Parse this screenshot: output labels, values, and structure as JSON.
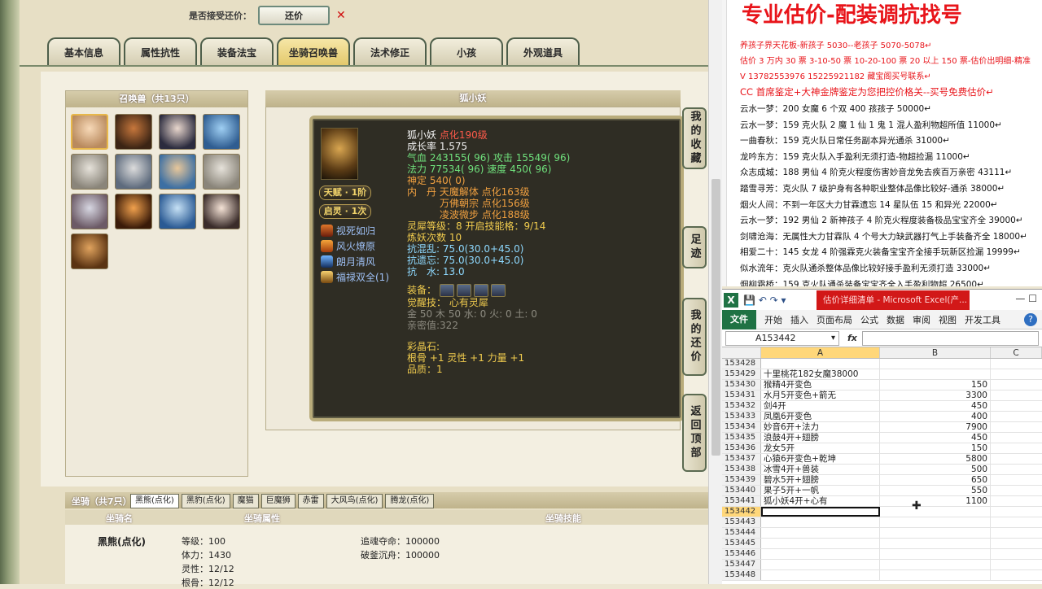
{
  "game": {
    "accept_label": "是否接受还价：",
    "accept_button": "还价",
    "accept_x": "✕",
    "tabs": [
      "基本信息",
      "属性抗性",
      "装备法宝",
      "坐骑召唤兽",
      "法术修正",
      "小孩",
      "外观道具"
    ],
    "active_tab": "坐骑召唤兽",
    "summon_header": "召唤兽（共13只）",
    "portrait_count": 13,
    "detail_title": "狐小妖",
    "pet": {
      "name": "狐小妖",
      "level": "点化190级",
      "growth": "成长率 1.575",
      "hp": "气血 243155( 96)",
      "attack": "攻击 15549( 96)",
      "mp": "法力 77534( 96)",
      "speed": "速度 450( 96)",
      "spirit": "神定 540( 0)",
      "inner_label": "内　丹",
      "inner1": "天魔解体 点化163级",
      "inner2": "万佛朝宗 点化156级",
      "inner3": "凌波微步 点化188级",
      "lingxi": "灵犀等级：8 开启技能格：9/14",
      "lianyao": "炼妖次数 10",
      "kang1": "抗混乱: 75.0(30.0+45.0)",
      "kang2": "抗遗忘: 75.0(30.0+45.0)",
      "kang3": "抗　水: 13.0",
      "equip_label": "装备：",
      "awaken_label": "觉醒技：",
      "awaken_value": "心有灵犀",
      "wuxing": "金 50 木 50 水: 0 火: 0 土: 0",
      "qinmi": "亲密值:322",
      "caijing_label": "彩晶石:",
      "caijing_value": "根骨 +1 灵性 +1 力量 +1",
      "pinzhi": "品质：1"
    },
    "badges": {
      "tianfu": "天赋 · 1阶",
      "qiling": "启灵 · 1次"
    },
    "skills": [
      "视死如归",
      "风火燎原",
      "朗月清风",
      "福禄双全(1)"
    ],
    "side_buttons": [
      "我的收藏",
      "足迹",
      "我的还价",
      "返回顶部"
    ],
    "mount": {
      "title": "坐骑（共7只）",
      "tabs": [
        "黑熊(点化)",
        "黑豹(点化)",
        "魔猫",
        "巨魔狮",
        "赤雷",
        "大风鸟(点化)",
        "腾龙(点化)"
      ],
      "col_name": "坐骑名",
      "col_attr": "坐骑属性",
      "col_skill": "坐骑技能",
      "name": "黑熊(点化)",
      "attrs": [
        "等级：100",
        "体力：1430",
        "灵性：12/12",
        "根骨：12/12"
      ],
      "skills": [
        "追魂夺命：100000",
        "破釜沉舟：100000"
      ]
    }
  },
  "doc": {
    "heading": "专业估价-配装调抗找号",
    "lines_red": [
      "养孩子界天花板-新孩子 5030--老孩子 5070-5078↵",
      "估价 3 万内 30 票  3-10-50 票  10-20-100 票  20 以上 150 票-估价出明细-精准",
      "V 13782553976    15225921182  藏宝阁买号联系↵",
      "CC 首席鉴定+大神金牌鉴定为您把控价格关--买号免费估价↵"
    ],
    "lines": [
      "云水一梦：200 女魔 6 个双 400 孩孩子 50000↵",
      "云水一梦：159 克火队 2 魔 1 仙 1 鬼 1 混人盈利物超所值 11000↵",
      "一曲春秋：159 克火队日常任务副本异光通杀 31000↵",
      "龙吟东方：159 克火队入手盈利无须打造-物超捡漏 11000↵",
      "众志成城：188 男仙 4 阶克火程度伤害妙音龙免去疾百万亲密 43111↵",
      "踏雪寻芳：克火队 7 级护身有各种职业整体品像比较好-通杀 38000↵",
      "烟火人间：不到一年区大力甘霖遗忘 14 星队伍 15 和异光 22000↵",
      "云水一梦：192 男仙 2 新神孩子 4 阶克火程度装备极品宝宝齐全 39000↵",
      "剑啸沧海：无属性大力甘霖队 4 个号大力缺武器打气上手装备齐全 18000↵",
      "相爱二十：145 女龙 4 阶强霖克火装备宝宝齐全接手玩新区捡漏 19999↵",
      "似水流年：克火队通杀整体品像比较好接手盈利无须打造 33000↵",
      "烟柳霜桥：159 克火队通杀装备宝宝齐全入手盈利物超 26500↵"
    ]
  },
  "excel": {
    "icon": "X",
    "title": "估价详细清单 - Microsoft Excel(产...",
    "ribbon": [
      "文件",
      "开始",
      "插入",
      "页面布局",
      "公式",
      "数据",
      "审阅",
      "视图",
      "开发工具"
    ],
    "help": "?",
    "namebox": "A153442",
    "fx": "fx",
    "cols": [
      "A",
      "B",
      "C"
    ],
    "rows": [
      {
        "n": "153428",
        "a": "",
        "b": ""
      },
      {
        "n": "153429",
        "a": "十里桃花182女魔38000",
        "b": ""
      },
      {
        "n": "153430",
        "a": "猴精4开变色",
        "b": "150"
      },
      {
        "n": "153431",
        "a": "水月5开变色+箭无",
        "b": "3300"
      },
      {
        "n": "153432",
        "a": "剑4开",
        "b": "450"
      },
      {
        "n": "153433",
        "a": "凤凰6开变色",
        "b": "400"
      },
      {
        "n": "153434",
        "a": "妙音6开+法力",
        "b": "7900"
      },
      {
        "n": "153435",
        "a": "浪鼓4开+翅膀",
        "b": "450"
      },
      {
        "n": "153436",
        "a": "龙女5开",
        "b": "150"
      },
      {
        "n": "153437",
        "a": "心猿6开变色+乾坤",
        "b": "5800"
      },
      {
        "n": "153438",
        "a": "冰雪4开+兽装",
        "b": "500"
      },
      {
        "n": "153439",
        "a": "碧水5开+翅膀",
        "b": "650"
      },
      {
        "n": "153440",
        "a": "果子5开+一帆",
        "b": "550"
      },
      {
        "n": "153441",
        "a": "狐小妖4开+心有",
        "b": "1100"
      },
      {
        "n": "153442",
        "a": "",
        "b": ""
      },
      {
        "n": "153443",
        "a": "",
        "b": ""
      },
      {
        "n": "153444",
        "a": "",
        "b": ""
      },
      {
        "n": "153445",
        "a": "",
        "b": ""
      },
      {
        "n": "153446",
        "a": "",
        "b": ""
      },
      {
        "n": "153447",
        "a": "",
        "b": ""
      },
      {
        "n": "153448",
        "a": "",
        "b": ""
      }
    ],
    "active_row": "153442"
  }
}
